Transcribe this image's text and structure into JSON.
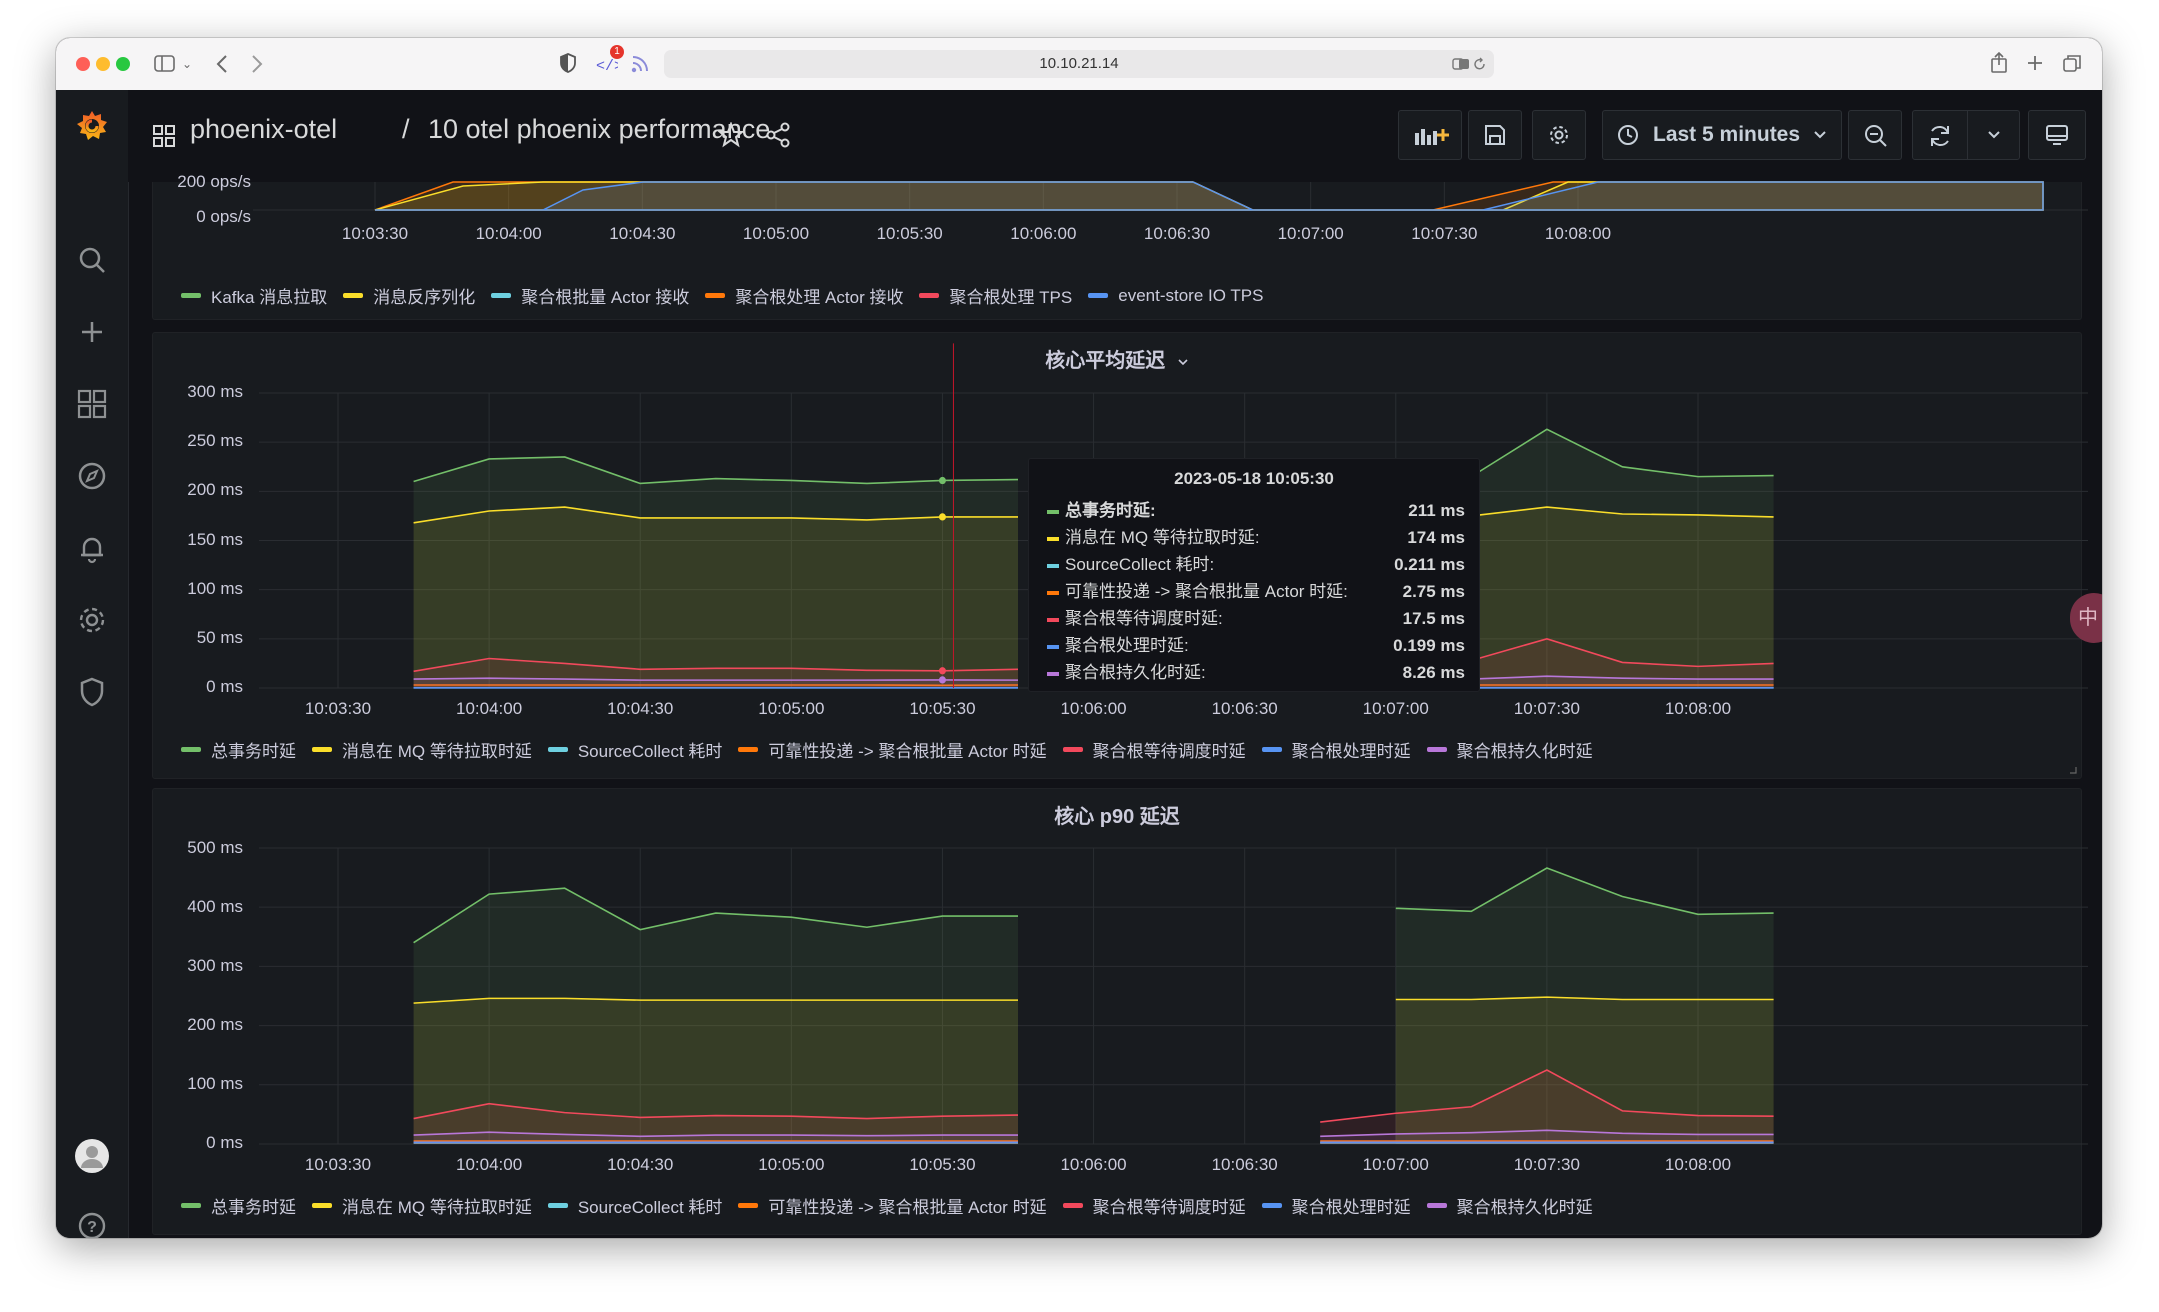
{
  "browser": {
    "url": "10.10.21.14",
    "rss_badge": "1"
  },
  "header": {
    "folder": "phoenix-otel",
    "separator": "/",
    "title": "10 otel phoenix performance",
    "time_range": "Last 5 minutes"
  },
  "colors": {
    "green": "#73bf69",
    "yellow": "#fade2a",
    "cyan": "#8ab8ff",
    "skyblue": "#6ed0e0",
    "orange": "#ff780a",
    "red": "#f2495c",
    "blue": "#5794f2",
    "purple": "#b877d9"
  },
  "panel_top": {
    "y_labels": [
      "200 ops/s",
      "0 ops/s"
    ],
    "x_labels": [
      "10:03:30",
      "10:04:00",
      "10:04:30",
      "10:05:00",
      "10:05:30",
      "10:06:00",
      "10:06:30",
      "10:07:00",
      "10:07:30",
      "10:08:00"
    ],
    "legend": [
      {
        "label": "Kafka 消息拉取",
        "color": "#73bf69"
      },
      {
        "label": "消息反序列化",
        "color": "#fade2a"
      },
      {
        "label": "聚合根批量 Actor 接收",
        "color": "#6ed0e0"
      },
      {
        "label": "聚合根处理 Actor 接收",
        "color": "#ff780a"
      },
      {
        "label": "聚合根处理 TPS",
        "color": "#f2495c"
      },
      {
        "label": "event-store IO TPS",
        "color": "#5794f2"
      }
    ]
  },
  "panel_avg": {
    "title": "核心平均延迟",
    "y_labels": [
      "300 ms",
      "250 ms",
      "200 ms",
      "150 ms",
      "100 ms",
      "50 ms",
      "0 ms"
    ],
    "x_labels": [
      "10:03:30",
      "10:04:00",
      "10:04:30",
      "10:05:00",
      "10:05:30",
      "10:06:00",
      "10:06:30",
      "10:07:00",
      "10:07:30",
      "10:08:00"
    ],
    "legend": [
      {
        "label": "总事务时延",
        "color": "#73bf69"
      },
      {
        "label": "消息在 MQ 等待拉取时延",
        "color": "#fade2a"
      },
      {
        "label": "SourceCollect 耗时",
        "color": "#6ed0e0"
      },
      {
        "label": "可靠性投递 -> 聚合根批量 Actor 时延",
        "color": "#ff780a"
      },
      {
        "label": "聚合根等待调度时延",
        "color": "#f2495c"
      },
      {
        "label": "聚合根处理时延",
        "color": "#5794f2"
      },
      {
        "label": "聚合根持久化时延",
        "color": "#b877d9"
      }
    ],
    "tooltip": {
      "time": "2023-05-18 10:05:30",
      "rows": [
        {
          "label": "总事务时延:",
          "value": "211 ms",
          "color": "#73bf69"
        },
        {
          "label": "消息在 MQ 等待拉取时延:",
          "value": "174 ms",
          "color": "#fade2a"
        },
        {
          "label": "SourceCollect 耗时:",
          "value": "0.211 ms",
          "color": "#6ed0e0"
        },
        {
          "label": "可靠性投递 -> 聚合根批量 Actor 时延:",
          "value": "2.75 ms",
          "color": "#ff780a"
        },
        {
          "label": "聚合根等待调度时延:",
          "value": "17.5 ms",
          "color": "#f2495c"
        },
        {
          "label": "聚合根处理时延:",
          "value": "0.199 ms",
          "color": "#5794f2"
        },
        {
          "label": "聚合根持久化时延:",
          "value": "8.26 ms",
          "color": "#b877d9"
        }
      ]
    }
  },
  "panel_p90": {
    "title": "核心 p90 延迟",
    "y_labels": [
      "500 ms",
      "400 ms",
      "300 ms",
      "200 ms",
      "100 ms",
      "0 ms"
    ],
    "x_labels": [
      "10:03:30",
      "10:04:00",
      "10:04:30",
      "10:05:00",
      "10:05:30",
      "10:06:00",
      "10:06:30",
      "10:07:00",
      "10:07:30",
      "10:08:00"
    ],
    "legend": [
      {
        "label": "总事务时延",
        "color": "#73bf69"
      },
      {
        "label": "消息在 MQ 等待拉取时延",
        "color": "#fade2a"
      },
      {
        "label": "SourceCollect 耗时",
        "color": "#6ed0e0"
      },
      {
        "label": "可靠性投递 -> 聚合根批量 Actor 时延",
        "color": "#ff780a"
      },
      {
        "label": "聚合根等待调度时延",
        "color": "#f2495c"
      },
      {
        "label": "聚合根处理时延",
        "color": "#5794f2"
      },
      {
        "label": "聚合根持久化时延",
        "color": "#b877d9"
      }
    ]
  },
  "chart_data": [
    {
      "type": "line",
      "title": "核心平均延迟",
      "x": [
        "10:03:45",
        "10:04:00",
        "10:04:15",
        "10:04:30",
        "10:04:45",
        "10:05:00",
        "10:05:15",
        "10:05:30",
        "10:05:45",
        "10:07:00",
        "10:07:15",
        "10:07:30",
        "10:07:45",
        "10:08:00",
        "10:08:15"
      ],
      "ylim": [
        0,
        300
      ],
      "unit": "ms",
      "series": [
        {
          "name": "总事务时延",
          "values": [
            210,
            233,
            235,
            208,
            213,
            211,
            208,
            211,
            212,
            215,
            215,
            263,
            225,
            215,
            216
          ]
        },
        {
          "name": "消息在 MQ 等待拉取时延",
          "values": [
            168,
            180,
            184,
            173,
            173,
            173,
            171,
            174,
            174,
            177,
            175,
            184,
            177,
            176,
            174
          ]
        },
        {
          "name": "SourceCollect 耗时",
          "values": [
            0.2,
            0.2,
            0.2,
            0.2,
            0.2,
            0.2,
            0.2,
            0.211,
            0.2,
            0.2,
            0.2,
            0.2,
            0.2,
            0.2,
            0.2
          ]
        },
        {
          "name": "可靠性投递 -> 聚合根批量 Actor 时延",
          "values": [
            3,
            3,
            3,
            3,
            3,
            3,
            3,
            2.75,
            3,
            3,
            3,
            3,
            3,
            3,
            3
          ]
        },
        {
          "name": "聚合根等待调度时延",
          "values": [
            17,
            30,
            25,
            19,
            20,
            20,
            18,
            17.5,
            19,
            23,
            28,
            50,
            26,
            22,
            25
          ]
        },
        {
          "name": "聚合根处理时延",
          "values": [
            0.2,
            0.2,
            0.2,
            0.2,
            0.2,
            0.2,
            0.2,
            0.199,
            0.2,
            0.2,
            0.2,
            0.2,
            0.2,
            0.2,
            0.2
          ]
        },
        {
          "name": "聚合根持久化时延",
          "values": [
            9,
            10,
            9,
            8,
            8,
            8,
            8,
            8.26,
            8,
            8,
            9,
            12,
            10,
            9,
            9
          ]
        }
      ]
    },
    {
      "type": "line",
      "title": "核心 p90 延迟",
      "x": [
        "10:03:45",
        "10:04:00",
        "10:04:15",
        "10:04:30",
        "10:04:45",
        "10:05:00",
        "10:05:15",
        "10:05:30",
        "10:05:45",
        "10:06:45",
        "10:07:00",
        "10:07:15",
        "10:07:30",
        "10:07:45",
        "10:08:00",
        "10:08:15"
      ],
      "ylim": [
        0,
        500
      ],
      "unit": "ms",
      "series": [
        {
          "name": "总事务时延",
          "values": [
            340,
            422,
            432,
            362,
            390,
            383,
            366,
            385,
            385,
            null,
            398,
            393,
            466,
            418,
            388,
            390
          ]
        },
        {
          "name": "消息在 MQ 等待拉取时延",
          "values": [
            238,
            246,
            246,
            243,
            243,
            243,
            243,
            243,
            243,
            null,
            244,
            244,
            248,
            244,
            244,
            244
          ]
        },
        {
          "name": "SourceCollect 耗时",
          "values": [
            2,
            2,
            2,
            2,
            2,
            2,
            2,
            2,
            2,
            2,
            2,
            2,
            2,
            2,
            2,
            2
          ]
        },
        {
          "name": "可靠性投递 -> 聚合根批量 Actor 时延",
          "values": [
            5,
            5,
            5,
            5,
            5,
            5,
            5,
            5,
            5,
            5,
            5,
            5,
            5,
            5,
            5,
            5
          ]
        },
        {
          "name": "聚合根等待调度时延",
          "values": [
            43,
            68,
            53,
            45,
            48,
            47,
            43,
            47,
            49,
            37,
            52,
            63,
            125,
            56,
            48,
            47
          ]
        },
        {
          "name": "聚合根处理时延",
          "values": [
            3,
            3,
            3,
            3,
            3,
            3,
            3,
            3,
            3,
            3,
            3,
            3,
            3,
            3,
            3,
            3
          ]
        },
        {
          "name": "聚合根持久化时延",
          "values": [
            15,
            20,
            16,
            13,
            15,
            15,
            14,
            15,
            15,
            13,
            17,
            19,
            23,
            18,
            16,
            16
          ]
        }
      ]
    }
  ]
}
